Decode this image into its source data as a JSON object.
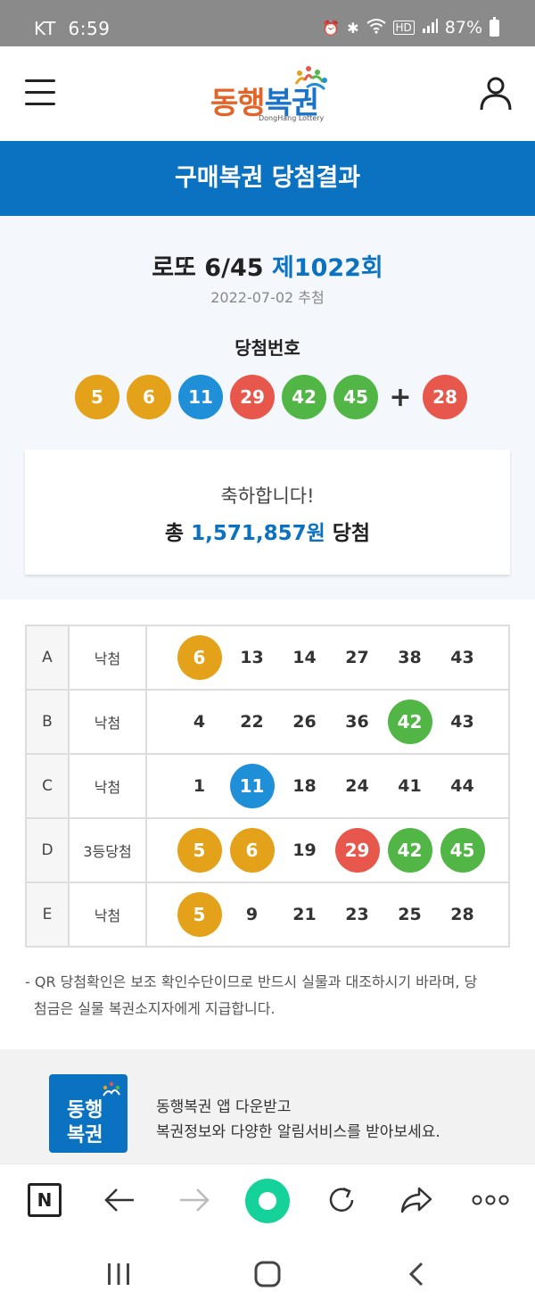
{
  "status_bar": {
    "carrier": "KT",
    "time": "6:59",
    "battery": "87%"
  },
  "header": {
    "logo_text_part1": "동행",
    "logo_text_part2": "복권",
    "logo_subtitle": "DongHang Lottery"
  },
  "page_title": "구매복권 당첨결과",
  "result": {
    "game_name": "로또 6/45",
    "round": "제1022회",
    "draw_date": "2022-07-02 추첨",
    "winning_label": "당첨번호",
    "winning_numbers": [
      {
        "num": "5",
        "color": "#e3a219"
      },
      {
        "num": "6",
        "color": "#e3a219"
      },
      {
        "num": "11",
        "color": "#1f8fd8"
      },
      {
        "num": "29",
        "color": "#e8574c"
      },
      {
        "num": "42",
        "color": "#52b646"
      },
      {
        "num": "45",
        "color": "#52b646"
      }
    ],
    "plus": "+",
    "bonus_number": {
      "num": "28",
      "color": "#e8574c"
    }
  },
  "congrats": {
    "line1": "축하합니다!",
    "prefix": "총",
    "amount": "1,571,857원",
    "suffix": "당첨"
  },
  "ticket": [
    {
      "label": "A",
      "status": "낙첨",
      "numbers": [
        {
          "n": "6",
          "hit": "y"
        },
        {
          "n": "13"
        },
        {
          "n": "14"
        },
        {
          "n": "27"
        },
        {
          "n": "38"
        },
        {
          "n": "43"
        }
      ]
    },
    {
      "label": "B",
      "status": "낙첨",
      "numbers": [
        {
          "n": "4"
        },
        {
          "n": "22"
        },
        {
          "n": "26"
        },
        {
          "n": "36"
        },
        {
          "n": "42",
          "hit": "g"
        },
        {
          "n": "43"
        }
      ]
    },
    {
      "label": "C",
      "status": "낙첨",
      "numbers": [
        {
          "n": "1"
        },
        {
          "n": "11",
          "hit": "bl"
        },
        {
          "n": "18"
        },
        {
          "n": "24"
        },
        {
          "n": "41"
        },
        {
          "n": "44"
        }
      ]
    },
    {
      "label": "D",
      "status": "3등당첨",
      "numbers": [
        {
          "n": "5",
          "hit": "y"
        },
        {
          "n": "6",
          "hit": "y"
        },
        {
          "n": "19"
        },
        {
          "n": "29",
          "hit": "r"
        },
        {
          "n": "42",
          "hit": "g"
        },
        {
          "n": "45",
          "hit": "g"
        }
      ]
    },
    {
      "label": "E",
      "status": "낙첨",
      "numbers": [
        {
          "n": "5",
          "hit": "y"
        },
        {
          "n": "9"
        },
        {
          "n": "21"
        },
        {
          "n": "23"
        },
        {
          "n": "25"
        },
        {
          "n": "28"
        }
      ]
    }
  ],
  "notice": {
    "line1": "- QR 당첨확인은 보조 확인수단이므로 반드시 실물과 대조하시기 바라며, 당",
    "line2": "첨금은 실물 복권소지자에게 지급합니다."
  },
  "app_banner": {
    "icon_line1": "동행",
    "icon_line2": "복권",
    "line1": "동행복권 앱 다운받고",
    "line2": "복권정보와 다양한 알림서비스를 받아보세요."
  },
  "toolbar": {
    "n_label": "N"
  },
  "colors": {
    "brand_blue": "#0b72c2",
    "ball_yellow": "#e3a219",
    "ball_blue": "#1f8fd8",
    "ball_red": "#e8574c",
    "ball_green": "#52b646",
    "home_green": "#15d29a"
  }
}
